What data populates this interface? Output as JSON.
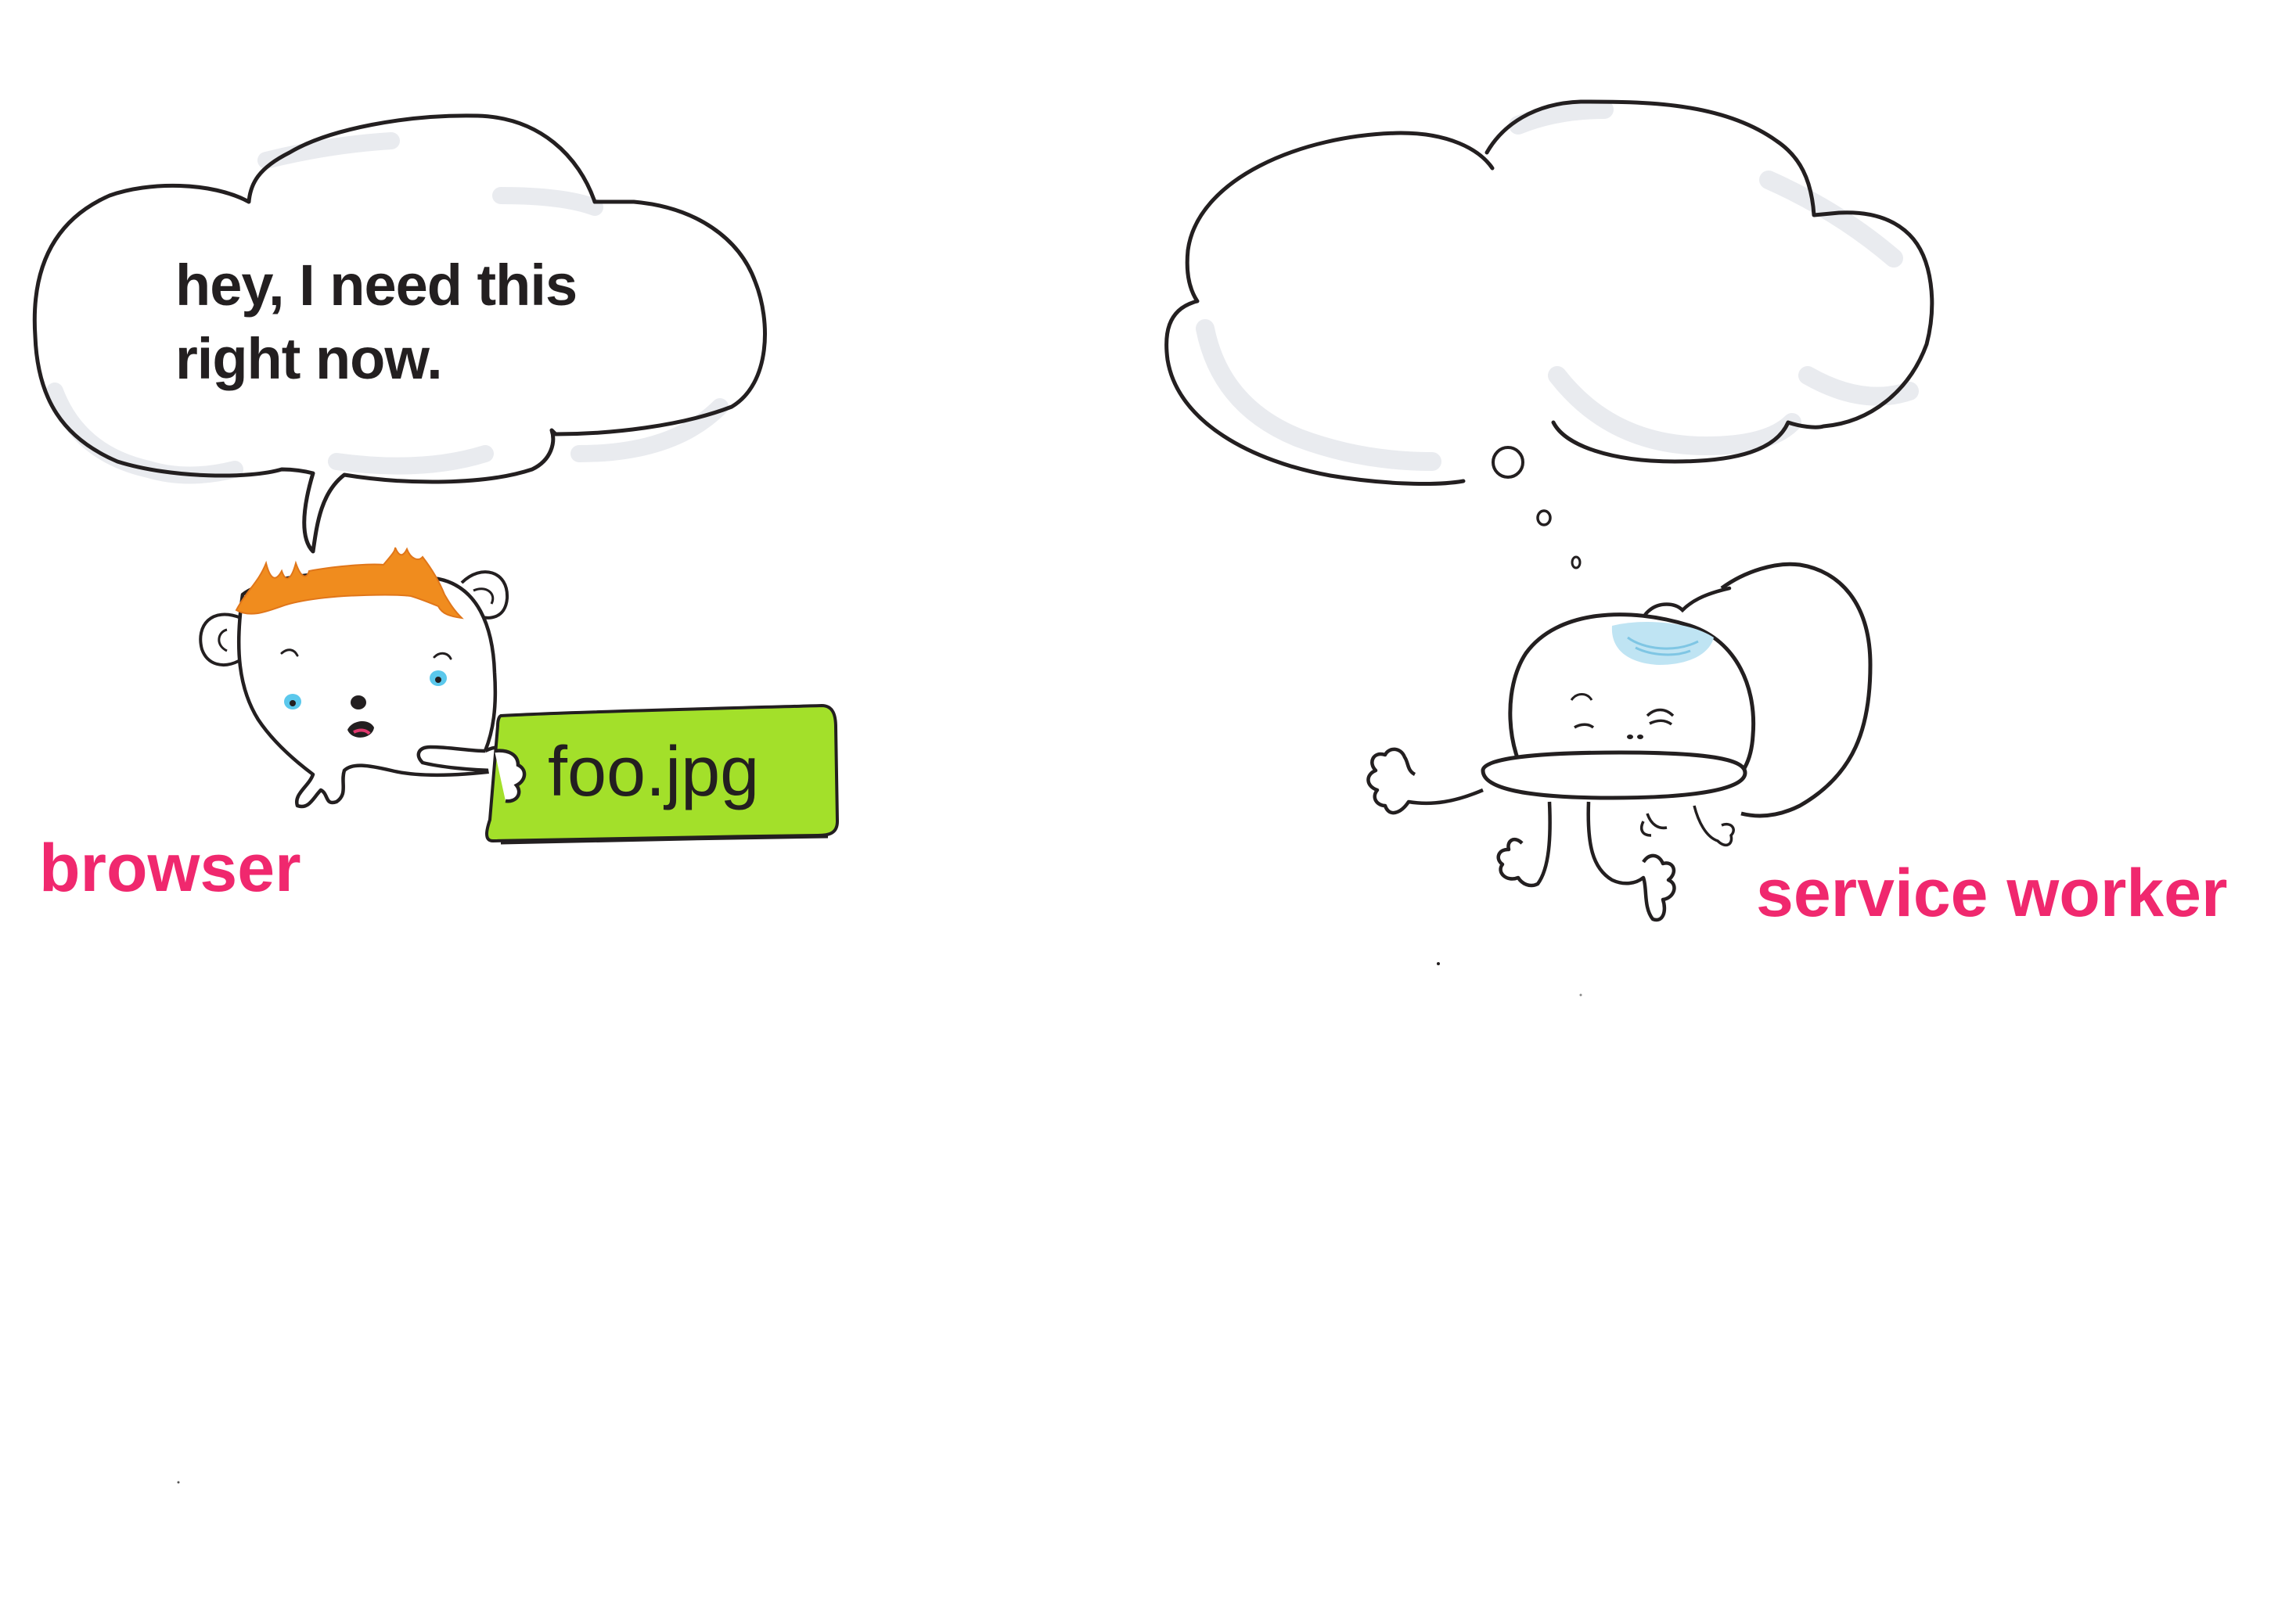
{
  "colors": {
    "label_pink": "#f0286e",
    "ink": "#231f20",
    "file_green": "#a3e02a",
    "hair_orange": "#f08c1e",
    "eye_blue": "#5bc8ec",
    "cloud_shadow": "#e9ebef",
    "ice_pack_blue": "#bfe4f3"
  },
  "browser": {
    "speech_lines": [
      "hey, I need this",
      "right now."
    ],
    "file_name": "foo.jpg",
    "label": "browser",
    "icons": [
      "speech-bubble-icon",
      "browser-character-icon",
      "file-card-icon"
    ]
  },
  "service_worker": {
    "label": "service worker",
    "icons": [
      "thought-bubble-icon",
      "service-worker-character-icon",
      "ice-pack-icon"
    ]
  }
}
